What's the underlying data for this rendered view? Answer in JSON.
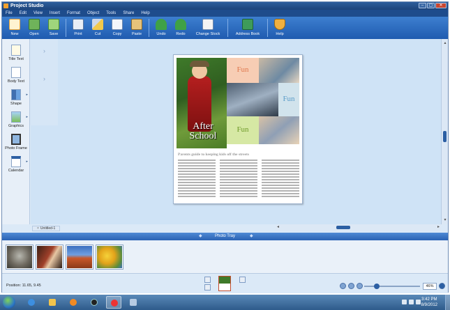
{
  "window": {
    "title": "Project Studio"
  },
  "menu": [
    "File",
    "Edit",
    "View",
    "Insert",
    "Format",
    "Object",
    "Tools",
    "Share",
    "Help"
  ],
  "toolbar": {
    "new": "New",
    "open": "Open",
    "save": "Save",
    "print": "Print",
    "cut": "Cut",
    "copy": "Copy",
    "paste": "Paste",
    "undo": "Undo",
    "redo": "Redo",
    "change_stock": "Change Stock",
    "address_book": "Address Book",
    "help": "Help"
  },
  "tools": {
    "title_text": "Title Text",
    "body_text": "Body Text",
    "shape": "Shape",
    "graphics": "Graphics",
    "photo_frame": "Photo Frame",
    "calendar": "Calendar"
  },
  "document": {
    "tab": "Untitled-1",
    "headline": "After School",
    "fun1": "Fun",
    "fun2": "Fun",
    "fun3": "Fun",
    "article_heading": "Parents guide to keeping kids off the streets"
  },
  "photo_tray": {
    "label": "Photo Tray"
  },
  "status": {
    "position": "Position: 11.65, 9.45",
    "zoom": "46%"
  },
  "taskbar": {
    "time": "3:42 PM",
    "date": "8/9/2012"
  },
  "colors": {
    "toolbar": "#2a67bd",
    "accent": "#2c5fa3",
    "fun_peach": "#f7cdb4",
    "fun_blue": "#d1e3ec",
    "fun_green": "#d6e8a4"
  }
}
